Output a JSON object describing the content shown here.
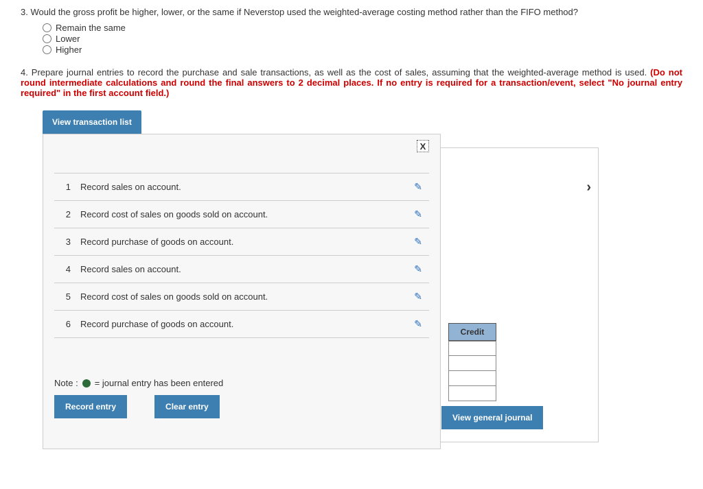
{
  "q3": {
    "num": "3.",
    "text": "Would the gross profit be higher, lower, or the same if Neverstop used the weighted-average costing method rather than the FIFO method?",
    "options": [
      "Remain the same",
      "Lower",
      "Higher"
    ]
  },
  "q4": {
    "num": "4.",
    "text_black": "Prepare journal entries to record the purchase and sale transactions, as well as the cost of sales, assuming that the weighted-average method is used. ",
    "text_red": "(Do not round intermediate calculations and round the final answers to 2 decimal places. If no entry is required for a transaction/event, select \"No journal entry required\" in the first account field.)"
  },
  "tab_label": "View transaction list",
  "close_x": "X",
  "transactions": [
    {
      "n": "1",
      "d": "Record sales on account."
    },
    {
      "n": "2",
      "d": "Record cost of sales on goods sold on account."
    },
    {
      "n": "3",
      "d": "Record purchase of goods on account."
    },
    {
      "n": "4",
      "d": "Record sales on account."
    },
    {
      "n": "5",
      "d": "Record cost of sales on goods sold on account."
    },
    {
      "n": "6",
      "d": "Record purchase of goods on account."
    }
  ],
  "note_prefix": "Note :",
  "note_text": "= journal entry has been entered",
  "btn_record": "Record entry",
  "btn_clear": "Clear entry",
  "btn_viewjournal": "View general journal",
  "credit_label": "Credit",
  "arrow": "›",
  "pencil": "✎"
}
